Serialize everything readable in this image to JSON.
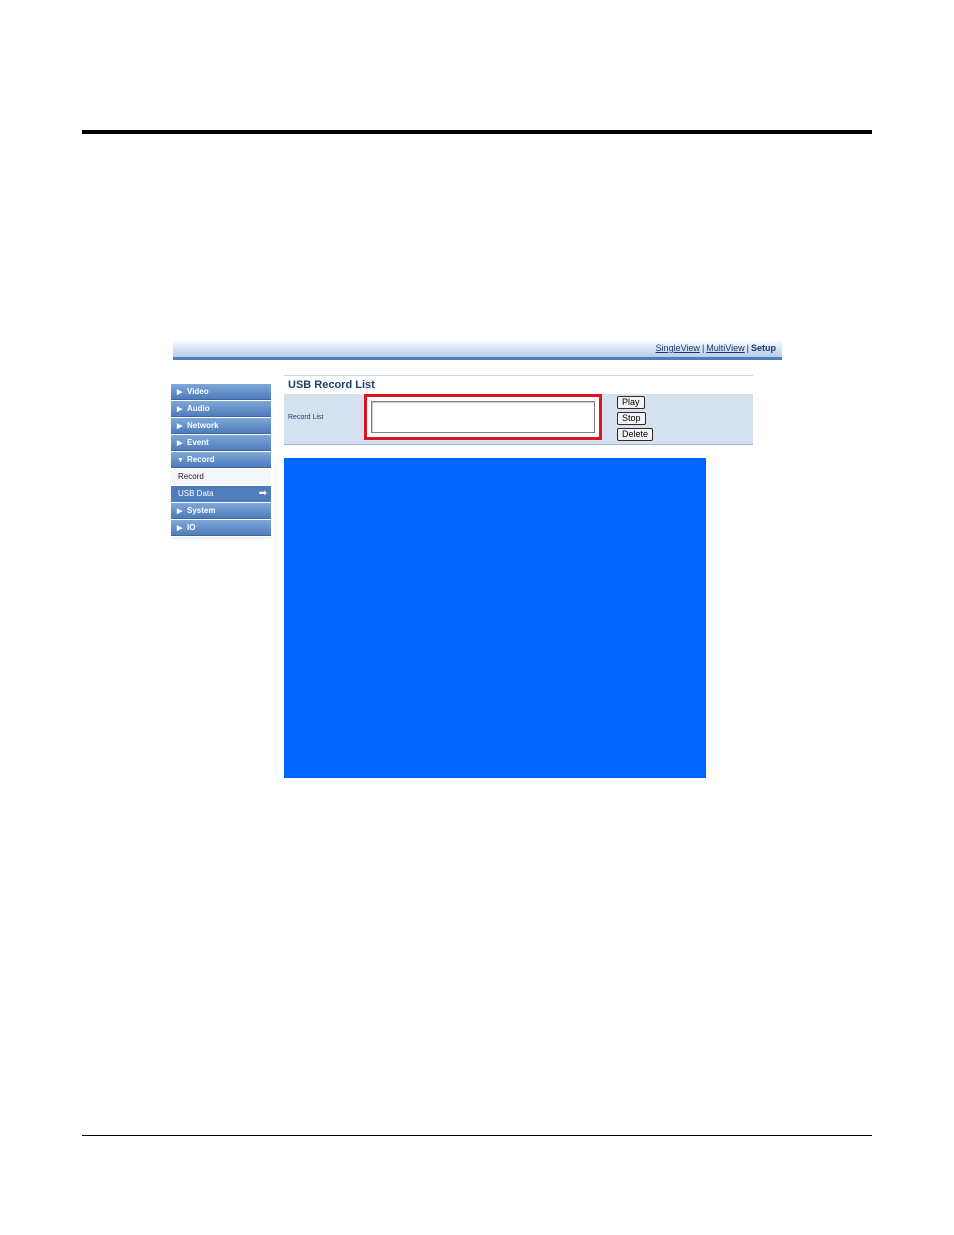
{
  "topnav": {
    "single_view": "SingleView",
    "separator": "|",
    "multi_view": "MultiView",
    "setup": "Setup"
  },
  "sidebar": {
    "items": [
      {
        "arrow": "▶",
        "label": "Video"
      },
      {
        "arrow": "▶",
        "label": "Audio"
      },
      {
        "arrow": "▶",
        "label": "Network"
      },
      {
        "arrow": "▶",
        "label": "Event"
      },
      {
        "arrow": "▼",
        "label": "Record"
      }
    ],
    "sub_items": [
      {
        "label": "Record"
      },
      {
        "label": "USB Data",
        "active_icon": "➡"
      }
    ],
    "more_items": [
      {
        "arrow": "▶",
        "label": "System"
      },
      {
        "arrow": "▶",
        "label": "IO"
      }
    ]
  },
  "panel": {
    "title": "USB Record List",
    "record_list_label": "Record List",
    "buttons": {
      "play": "Play",
      "stop": "Stop",
      "delete": "Delete"
    }
  },
  "colors": {
    "accent": "#4f7dbb",
    "highlight": "#e0121b",
    "video_bg": "#0066ff"
  }
}
